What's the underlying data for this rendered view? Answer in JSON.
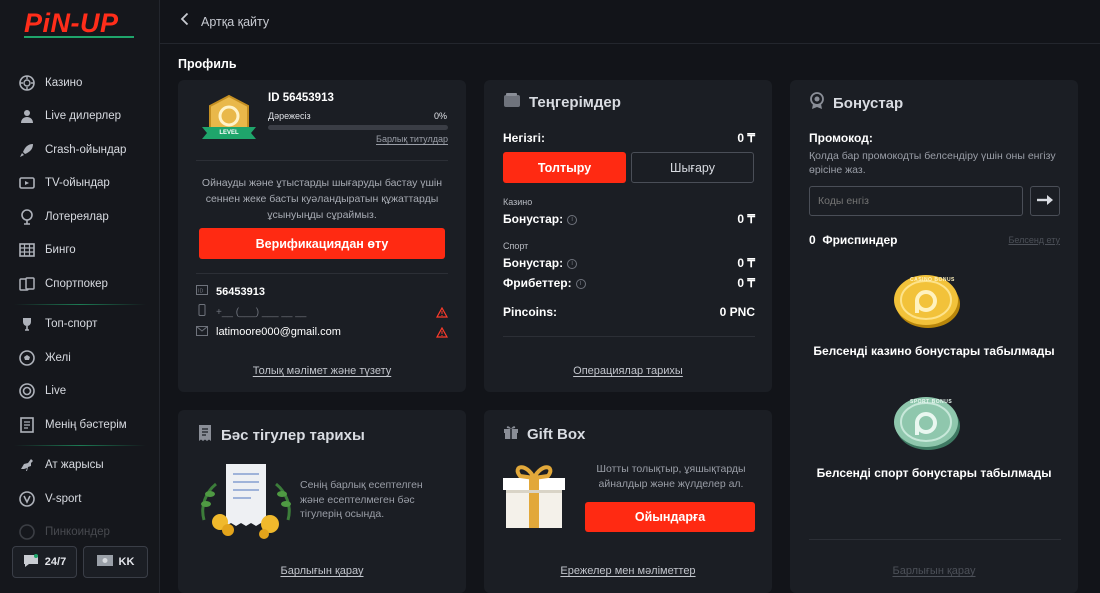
{
  "brand": {
    "logo": "PiN-UP"
  },
  "nav": {
    "items": [
      {
        "label": "Казино",
        "icon": "casino-chip-icon"
      },
      {
        "label": "Live дилерлер",
        "icon": "dealer-icon"
      },
      {
        "label": "Crash-ойындар",
        "icon": "rocket-icon"
      },
      {
        "label": "TV-ойындар",
        "icon": "tv-icon"
      },
      {
        "label": "Лотереялар",
        "icon": "lottery-icon"
      },
      {
        "label": "Бинго",
        "icon": "bingo-icon"
      },
      {
        "label": "Спортпокер",
        "icon": "cards-icon"
      },
      {
        "label": "Топ-спорт",
        "icon": "trophy-icon"
      },
      {
        "label": "Желі",
        "icon": "soccer-ball-icon"
      },
      {
        "label": "Live",
        "icon": "live-icon"
      },
      {
        "label": "Менің бәстерім",
        "icon": "bets-list-icon"
      },
      {
        "label": "Ат жарысы",
        "icon": "horse-icon"
      },
      {
        "label": "V-sport",
        "icon": "vsport-icon"
      },
      {
        "label": "Пинкоиндер",
        "icon": "pincoin-icon"
      }
    ],
    "support_label": "24/7",
    "lang_label": "KK"
  },
  "topbar": {
    "back_label": "Артқа қайту"
  },
  "page_title": "Профиль",
  "profile": {
    "id_text": "ID 56453913",
    "level_label": "Дәрежесіз",
    "level_progress_text": "0%",
    "level_progress": 0,
    "badge_text": "LEVEL",
    "all_titles_link": "Барлық титулдар",
    "verify_note": "Ойнауды және ұтыстарды шығаруды бастау үшін сеннен жеке басты куәландыратын құжаттарды ұсынуыңды сұраймыз.",
    "verify_button": "Верификациядан өту",
    "user_id": "56453913",
    "phone_placeholder": "+__ (___) ___ __ __",
    "email": "latimoore000@gmail.com",
    "edit_link": "Толық мәлімет және түзету"
  },
  "balances": {
    "title": "Теңгерімдер",
    "main_label": "Негізгі:",
    "main_value": "0 ₸",
    "deposit_button": "Толтыру",
    "withdraw_button": "Шығару",
    "casino_section": "Казино",
    "casino_bonus_label": "Бонустар:",
    "casino_bonus_value": "0 ₸",
    "sport_section": "Спорт",
    "sport_bonus_label": "Бонустар:",
    "sport_bonus_value": "0 ₸",
    "freebets_label": "Фрибеттер:",
    "freebets_value": "0 ₸",
    "pincoins_label": "Pincoins:",
    "pincoins_value": "0 PNC",
    "history_link": "Операциялар тарихы"
  },
  "bonuses": {
    "title": "Бонустар",
    "promo_label": "Промокод:",
    "promo_note": "Қолда бар промокодты белсендіру үшін оны енгізу өрісіне жаз.",
    "promo_placeholder": "Коды енгіз",
    "freespins_count": "0",
    "freespins_label": "Фриспиндер",
    "activate_link": "Белсенд ету",
    "casino_empty": "Белсенді казино бонустары табылмады",
    "sport_empty": "Белсенді спорт бонустары табылмады",
    "all_link": "Барлығын қарау",
    "coin_gold_text": "CASINO BONUS",
    "coin_green_text": "SPORT BONUS"
  },
  "bet_history": {
    "title": "Бәс тігулер тарихы",
    "description": "Сенің барлық есептелген және есептелмеген бәс тігулерің осында.",
    "all_link": "Барлығын қарау"
  },
  "gift_box": {
    "title": "Gift Box",
    "description": "Шотты толықтыр, ұяшықтарды айналдыр және жүлделер ал.",
    "play_button": "Ойындарға",
    "rules_link": "Ережелер мен мәліметтер"
  },
  "colors": {
    "accent": "#ff2a12",
    "brand_green": "#1fa56b",
    "card_bg": "#1b1e24",
    "page_bg": "#121419"
  }
}
